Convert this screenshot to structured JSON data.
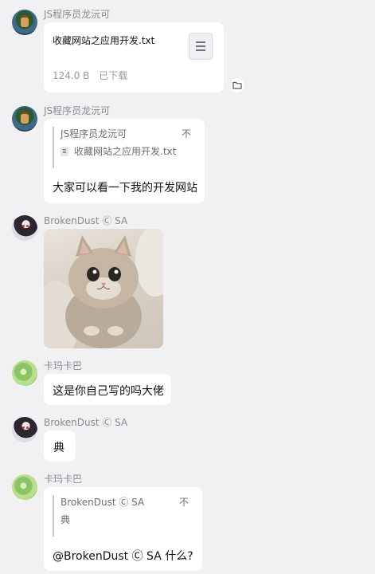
{
  "messages": [
    {
      "sender": "JS程序员龙沅可",
      "file": {
        "name": "收藏网站之应用开发.txt",
        "size": "124.0 B",
        "status": "已下载"
      }
    },
    {
      "sender": "JS程序员龙沅可",
      "quote": {
        "author": "JS程序员龙沅可",
        "close": "不",
        "content": "收藏网站之应用开发.txt"
      },
      "text": "大家可以看一下我的开发网站"
    },
    {
      "sender": "BrokenDust Ⓒ SA",
      "image": "cat-photo"
    },
    {
      "sender": "卡玛卡巴",
      "text": "这是你自己写的吗大佬"
    },
    {
      "sender": "BrokenDust Ⓒ SA",
      "text": "典"
    },
    {
      "sender": "卡玛卡巴",
      "quote": {
        "author": "BrokenDust Ⓒ SA",
        "close": "不",
        "content": "典"
      },
      "text": "@BrokenDust Ⓒ SA 什么?"
    }
  ],
  "icons": {
    "file": "text-file-icon",
    "folder": "folder-icon",
    "quote_file": "file-icon"
  },
  "colors": {
    "background": "#f1f1f3",
    "bubble": "#ffffff",
    "sender_text": "#8a8a8f",
    "quote_bar": "#c7c7cc"
  }
}
